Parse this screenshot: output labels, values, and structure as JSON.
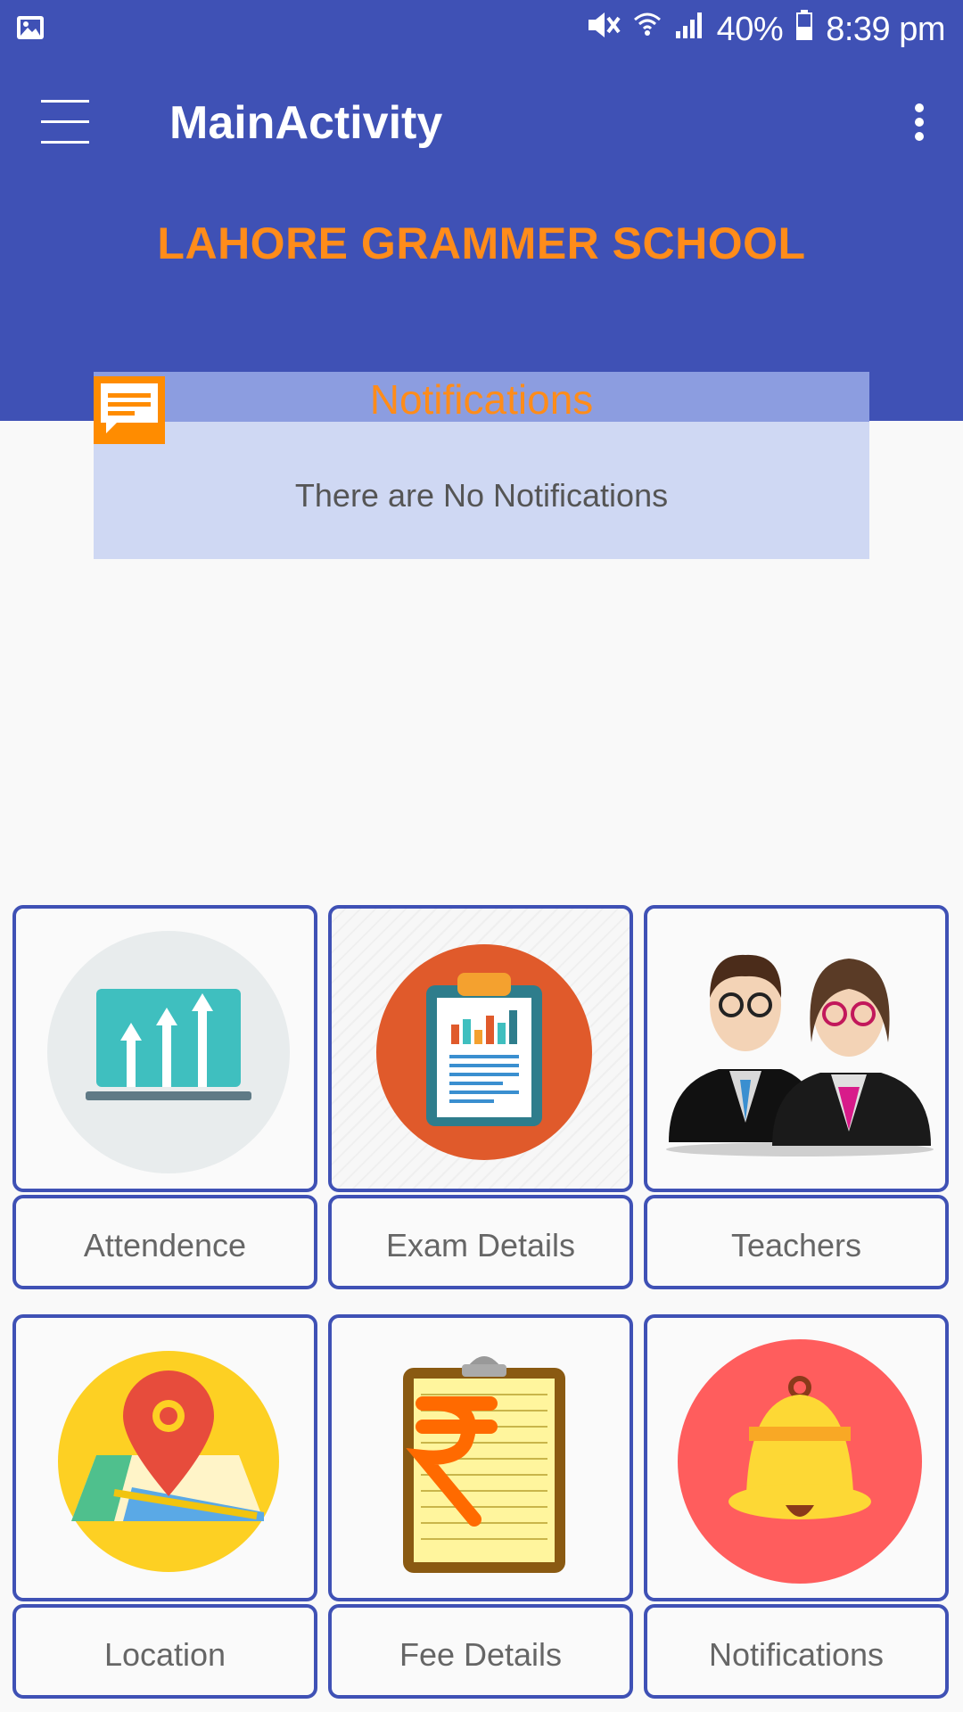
{
  "status_bar": {
    "battery_percent": "40%",
    "time": "8:39 pm",
    "icons": [
      "gallery-icon",
      "mute-icon",
      "wifi-icon",
      "signal-icon",
      "battery-icon"
    ]
  },
  "toolbar": {
    "title": "MainActivity",
    "menu_icon": "hamburger-menu-icon",
    "overflow_icon": "more-vert-icon"
  },
  "header": {
    "school_name": "LAHORE GRAMMER SCHOOL"
  },
  "notifications_card": {
    "title": "Notifications",
    "empty_text": "There are No Notifications",
    "icon": "message-icon"
  },
  "tiles": [
    {
      "label": "Attendence",
      "icon": "attendance-chart-icon"
    },
    {
      "label": "Exam Details",
      "icon": "clipboard-report-icon"
    },
    {
      "label": "Teachers",
      "icon": "teachers-icon"
    },
    {
      "label": "Location",
      "icon": "map-pin-icon"
    },
    {
      "label": "Fee Details",
      "icon": "fees-clipboard-icon"
    },
    {
      "label": "Notifications",
      "icon": "bell-icon"
    }
  ],
  "colors": {
    "primary": "#3f51b5",
    "accent": "#ff8c1a",
    "card_bg": "#cfd8f3",
    "card_header": "#8c9de0"
  }
}
